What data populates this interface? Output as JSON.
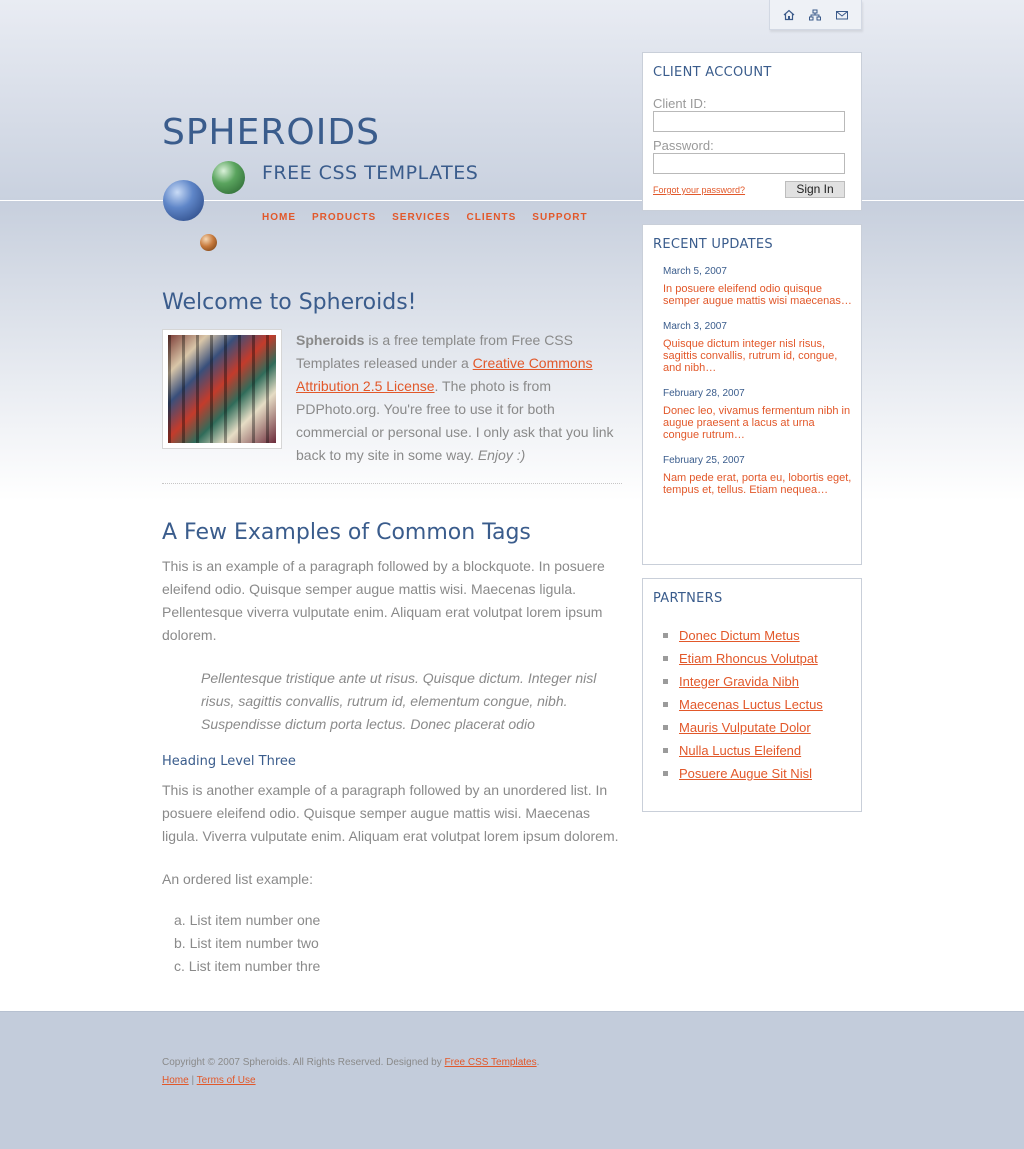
{
  "header": {
    "site_title": "SPHEROIDS",
    "tagline": "FREE CSS TEMPLATES",
    "top_icons": [
      "home-icon",
      "sitemap-icon",
      "mail-icon"
    ],
    "nav": [
      "HOME",
      "PRODUCTS",
      "SERVICES",
      "CLIENTS",
      "SUPPORT"
    ]
  },
  "main": {
    "welcome_title": "Welcome to Spheroids!",
    "intro": {
      "brand": "Spheroids",
      "text1": " is a free template from Free CSS Templates released under a ",
      "license_link": "Creative Commons Attribution 2.5 License",
      "text2": ". The photo is from PDPhoto.org. You're free to use it for both commercial or personal use. I only ask that you link back to my site in some way. ",
      "enjoy": "Enjoy :)"
    },
    "tags_title": "A Few Examples of Common Tags",
    "paragraph1": "This is an example of a paragraph followed by a blockquote. In posuere eleifend odio. Quisque semper augue mattis wisi. Maecenas ligula. Pellentesque viverra vulputate enim. Aliquam erat volutpat lorem ipsum dolorem.",
    "blockquote": "Pellentesque tristique ante ut risus. Quisque dictum. Integer nisl risus, sagittis convallis, rutrum id, elementum congue, nibh. Suspendisse dictum porta lectus. Donec placerat odio",
    "heading3": "Heading Level Three",
    "paragraph2": "This is another example of a paragraph followed by an unordered list. In posuere eleifend odio. Quisque semper augue mattis wisi. Maecenas ligula. Viverra vulputate enim. Aliquam erat volutpat lorem ipsum dolorem.",
    "ordered_intro": "An ordered list example:",
    "ordered_items": [
      {
        "marker": "a.",
        "text": "List item number one"
      },
      {
        "marker": "b.",
        "text": "List item number two"
      },
      {
        "marker": "c.",
        "text": "List item number thre"
      }
    ]
  },
  "sidebar": {
    "account": {
      "title": "CLIENT ACCOUNT",
      "client_id_label": "Client ID:",
      "client_id_value": "",
      "password_label": "Password:",
      "password_value": "",
      "forgot": "Forgot your password?",
      "signin": "Sign In"
    },
    "updates": {
      "title": "RECENT UPDATES",
      "items": [
        {
          "date": "March 5, 2007",
          "text": "In posuere eleifend odio quisque semper augue mattis wisi maecenas…"
        },
        {
          "date": "March 3, 2007",
          "text": "Quisque dictum integer nisl risus, sagittis convallis, rutrum id, congue, and nibh…"
        },
        {
          "date": "February 28, 2007",
          "text": "Donec leo, vivamus fermentum nibh in augue praesent a lacus at urna congue rutrum…"
        },
        {
          "date": "February 25, 2007",
          "text": "Nam pede erat, porta eu, lobortis eget, tempus et, tellus. Etiam nequea…"
        }
      ]
    },
    "partners": {
      "title": "PARTNERS",
      "links": [
        "Donec Dictum Metus",
        "Etiam Rhoncus Volutpat",
        "Integer Gravida Nibh",
        "Maecenas Luctus Lectus",
        "Mauris Vulputate Dolor",
        "Nulla Luctus Eleifend",
        "Posuere Augue Sit Nisl"
      ]
    }
  },
  "footer": {
    "copyright": "Copyright © 2007 Spheroids. All Rights Reserved. Designed by ",
    "designer_link": "Free CSS Templates",
    "period": ".",
    "home_link": "Home",
    "separator": " | ",
    "terms_link": "Terms of Use"
  },
  "colors": {
    "accent": "#e2582a",
    "heading": "#3a5c8c",
    "text": "#8a8a8a",
    "footer_bg": "#c3ccdb"
  }
}
